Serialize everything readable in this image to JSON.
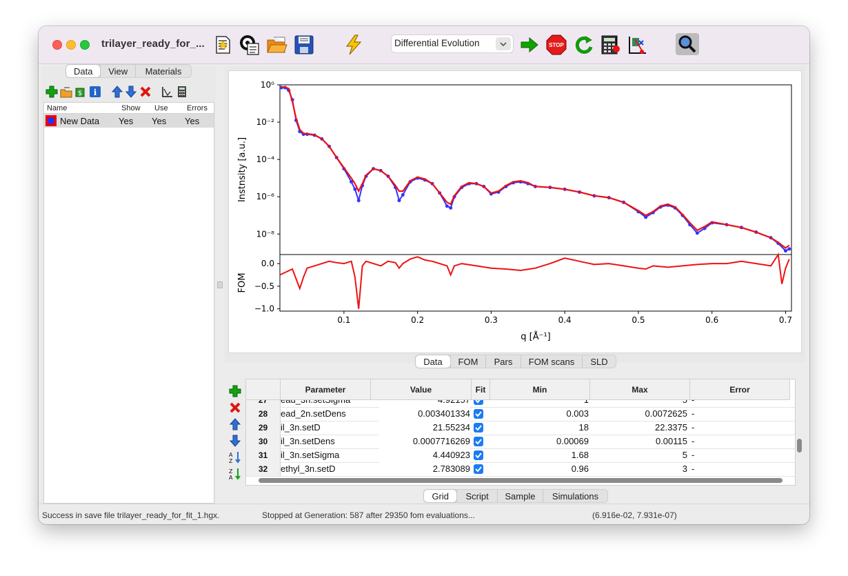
{
  "window": {
    "title": "trilayer_ready_for_..."
  },
  "toolbar": {
    "algorithm": "Differential Evolution",
    "icons": [
      "new-file-icon",
      "save-sim-icon",
      "open-folder-icon",
      "save-icon",
      "simulate-lightning-icon",
      "start-fit-arrow-icon",
      "stop-icon",
      "restart-icon",
      "calculator-icon",
      "parameter-scan-icon",
      "zoom-icon"
    ]
  },
  "left_panel": {
    "tabs": [
      "Data",
      "View",
      "Materials"
    ],
    "active_tab": "Data",
    "columns": [
      "Name",
      "Show",
      "Use",
      "Errors"
    ],
    "rows": [
      {
        "name": "New Data",
        "show": "Yes",
        "use": "Yes",
        "errors": "Yes"
      }
    ]
  },
  "plot_tabs": [
    "Data",
    "FOM",
    "Pars",
    "FOM scans",
    "SLD"
  ],
  "plot_active_tab": "Data",
  "chart_data": {
    "type": "line",
    "ylabel_top": "Instnsity [a.u.]",
    "ylabel_bottom": "FOM",
    "xlabel": "q [Å⁻¹]",
    "x_ticks": [
      "0.1",
      "0.2",
      "0.3",
      "0.4",
      "0.5",
      "0.6",
      "0.7"
    ],
    "y_ticks_top": [
      "10⁰",
      "10⁻²",
      "10⁻⁴",
      "10⁻⁶",
      "10⁻⁸"
    ],
    "y_ticks_bottom": [
      "0.0",
      "−0.5",
      "−1.0"
    ],
    "yscale_top": "log",
    "xlim": [
      0.013,
      0.708
    ],
    "ylim_top_log10": [
      -9.1,
      0.0
    ],
    "ylim_bottom": [
      -1.05,
      0.2
    ],
    "colors": {
      "data": "#3333ff",
      "sim": "#ee1111"
    },
    "series": [
      {
        "name": "data",
        "x": [
          0.015,
          0.02,
          0.025,
          0.03,
          0.035,
          0.04,
          0.045,
          0.05,
          0.06,
          0.07,
          0.08,
          0.09,
          0.1,
          0.11,
          0.115,
          0.12,
          0.125,
          0.13,
          0.14,
          0.15,
          0.16,
          0.17,
          0.175,
          0.18,
          0.19,
          0.2,
          0.21,
          0.22,
          0.23,
          0.24,
          0.245,
          0.25,
          0.26,
          0.27,
          0.28,
          0.29,
          0.3,
          0.31,
          0.32,
          0.33,
          0.34,
          0.35,
          0.36,
          0.38,
          0.4,
          0.42,
          0.44,
          0.46,
          0.48,
          0.5,
          0.51,
          0.52,
          0.53,
          0.54,
          0.55,
          0.56,
          0.57,
          0.58,
          0.59,
          0.6,
          0.62,
          0.64,
          0.66,
          0.68,
          0.69,
          0.7,
          0.705
        ],
        "y_log10": [
          -0.15,
          -0.15,
          -0.3,
          -0.8,
          -1.9,
          -2.5,
          -2.65,
          -2.65,
          -2.7,
          -2.9,
          -3.3,
          -3.9,
          -4.5,
          -5.2,
          -5.6,
          -6.2,
          -5.4,
          -4.9,
          -4.5,
          -4.6,
          -4.9,
          -5.5,
          -6.2,
          -5.9,
          -5.2,
          -5.0,
          -5.1,
          -5.3,
          -5.8,
          -6.5,
          -6.6,
          -6.0,
          -5.5,
          -5.3,
          -5.3,
          -5.45,
          -5.85,
          -5.75,
          -5.45,
          -5.25,
          -5.2,
          -5.3,
          -5.45,
          -5.5,
          -5.6,
          -5.75,
          -5.95,
          -6.05,
          -6.3,
          -6.8,
          -7.1,
          -6.85,
          -6.55,
          -6.45,
          -6.6,
          -7.0,
          -7.5,
          -7.95,
          -7.7,
          -7.4,
          -7.5,
          -7.65,
          -7.9,
          -8.2,
          -8.5,
          -8.9,
          -8.8
        ]
      },
      {
        "name": "sim",
        "x": [
          0.015,
          0.02,
          0.025,
          0.03,
          0.035,
          0.04,
          0.045,
          0.05,
          0.06,
          0.07,
          0.08,
          0.09,
          0.1,
          0.11,
          0.115,
          0.12,
          0.125,
          0.13,
          0.14,
          0.15,
          0.16,
          0.17,
          0.175,
          0.18,
          0.19,
          0.2,
          0.21,
          0.22,
          0.23,
          0.24,
          0.245,
          0.25,
          0.26,
          0.27,
          0.28,
          0.29,
          0.3,
          0.31,
          0.32,
          0.33,
          0.34,
          0.35,
          0.36,
          0.38,
          0.4,
          0.42,
          0.44,
          0.46,
          0.48,
          0.5,
          0.51,
          0.52,
          0.53,
          0.54,
          0.55,
          0.56,
          0.57,
          0.58,
          0.59,
          0.6,
          0.62,
          0.64,
          0.66,
          0.68,
          0.69,
          0.7,
          0.705
        ],
        "y_log10": [
          -0.12,
          -0.12,
          -0.2,
          -0.9,
          -1.8,
          -2.4,
          -2.6,
          -2.62,
          -2.68,
          -2.9,
          -3.3,
          -3.9,
          -4.45,
          -5.0,
          -5.3,
          -5.7,
          -5.3,
          -4.85,
          -4.5,
          -4.6,
          -4.9,
          -5.4,
          -5.7,
          -5.7,
          -5.15,
          -4.95,
          -5.05,
          -5.3,
          -5.8,
          -6.3,
          -6.4,
          -5.95,
          -5.45,
          -5.25,
          -5.3,
          -5.45,
          -5.8,
          -5.7,
          -5.4,
          -5.2,
          -5.15,
          -5.25,
          -5.45,
          -5.5,
          -5.6,
          -5.75,
          -5.95,
          -6.05,
          -6.3,
          -6.75,
          -7.0,
          -6.8,
          -6.5,
          -6.4,
          -6.55,
          -6.95,
          -7.4,
          -7.8,
          -7.6,
          -7.35,
          -7.5,
          -7.65,
          -7.9,
          -8.2,
          -8.45,
          -8.75,
          -8.6
        ]
      },
      {
        "name": "FOM",
        "x": [
          0.013,
          0.03,
          0.04,
          0.045,
          0.05,
          0.06,
          0.07,
          0.08,
          0.09,
          0.1,
          0.11,
          0.115,
          0.12,
          0.125,
          0.13,
          0.14,
          0.15,
          0.16,
          0.17,
          0.175,
          0.18,
          0.19,
          0.2,
          0.21,
          0.22,
          0.23,
          0.24,
          0.245,
          0.25,
          0.26,
          0.28,
          0.3,
          0.32,
          0.34,
          0.36,
          0.38,
          0.4,
          0.42,
          0.44,
          0.46,
          0.48,
          0.5,
          0.51,
          0.52,
          0.54,
          0.56,
          0.58,
          0.6,
          0.62,
          0.64,
          0.66,
          0.68,
          0.69,
          0.695,
          0.7,
          0.705
        ],
        "y": [
          -0.25,
          -0.12,
          -0.55,
          -0.3,
          -0.1,
          -0.05,
          0.0,
          0.05,
          0.02,
          0.0,
          0.05,
          -0.3,
          -1.0,
          -0.05,
          0.05,
          0.0,
          -0.05,
          0.05,
          0.02,
          -0.1,
          0.0,
          0.1,
          0.15,
          0.08,
          0.05,
          0.0,
          -0.05,
          -0.25,
          -0.05,
          0.0,
          -0.05,
          -0.1,
          -0.12,
          -0.15,
          -0.1,
          0.0,
          0.12,
          0.05,
          -0.02,
          0.0,
          -0.05,
          -0.1,
          -0.12,
          -0.05,
          -0.08,
          -0.05,
          -0.02,
          0.0,
          0.0,
          0.05,
          0.0,
          -0.05,
          0.2,
          -0.45,
          -0.1,
          0.1
        ]
      }
    ]
  },
  "grid": {
    "columns": [
      "Parameter",
      "Value",
      "Fit",
      "Min",
      "Max",
      "Error"
    ],
    "rows": [
      {
        "n": "27",
        "param": "ead_3n.setSigma",
        "value": "4.92157",
        "min": "1",
        "max": "5",
        "error": "-"
      },
      {
        "n": "28",
        "param": "ead_2n.setDens",
        "value": "0.003401334",
        "min": "0.003",
        "max": "0.0072625",
        "error": "-"
      },
      {
        "n": "29",
        "param": "il_3n.setD",
        "value": "21.55234",
        "min": "18",
        "max": "22.3375",
        "error": "-"
      },
      {
        "n": "30",
        "param": "il_3n.setDens",
        "value": "0.0007716269",
        "min": "0.00069",
        "max": "0.00115",
        "error": "-"
      },
      {
        "n": "31",
        "param": "il_3n.setSigma",
        "value": "4.440923",
        "min": "1.68",
        "max": "5",
        "error": "-"
      },
      {
        "n": "32",
        "param": "ethyl_3n.setD",
        "value": "2.783089",
        "min": "0.96",
        "max": "3",
        "error": "-"
      }
    ]
  },
  "bottom_tabs": [
    "Grid",
    "Script",
    "Sample",
    "Simulations"
  ],
  "bottom_active_tab": "Grid",
  "status": {
    "left": "Success in save file trilayer_ready_for_fit_1.hgx.",
    "middle": "Stopped at Generation: 587 after 29350 fom evaluations...",
    "right": "(6.916e-02, 7.931e-07)"
  }
}
